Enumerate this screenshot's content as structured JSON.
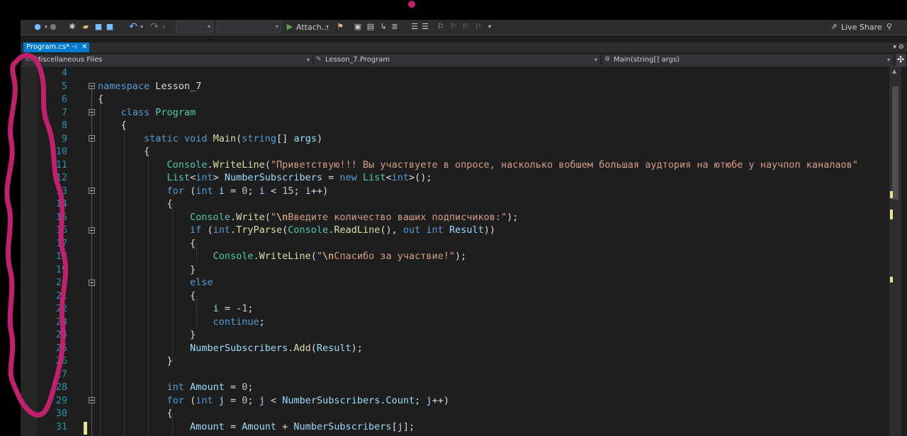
{
  "toolbar": {
    "attach_label": "Attach...",
    "live_share_label": "Live Share",
    "icons": [
      "back-icon",
      "forward-icon",
      "new-project-icon",
      "open-icon",
      "save-icon",
      "save-all-icon",
      "undo-icon",
      "redo-icon",
      "start-icon",
      "attach-icon",
      "layout-icon",
      "comment-icon",
      "bookmark-icon",
      "search-icon"
    ]
  },
  "tab": {
    "label": "Program.cs*",
    "pin": "⊣",
    "close": "✕"
  },
  "navbar": {
    "project": "Miscellaneous Files",
    "type": "Lesson_7.Program",
    "member": "Main(string[] args)"
  },
  "editor": {
    "line_numbers": [
      "4",
      "5",
      "6",
      "7",
      "8",
      "9",
      "10",
      "11",
      "12",
      "13",
      "14",
      "15",
      "16",
      "17",
      "18",
      "19",
      "20",
      "21",
      "22",
      "23",
      "24",
      "25",
      "26",
      "27",
      "28",
      "29",
      "30",
      "31"
    ]
  },
  "colors": {
    "keyword": "#569cd6",
    "type": "#4ec9b0",
    "method": "#dcdcaa",
    "string": "#d69d85",
    "line_number": "#2b91af",
    "tab_accent": "#007acc",
    "scribble": "#c0206e"
  }
}
